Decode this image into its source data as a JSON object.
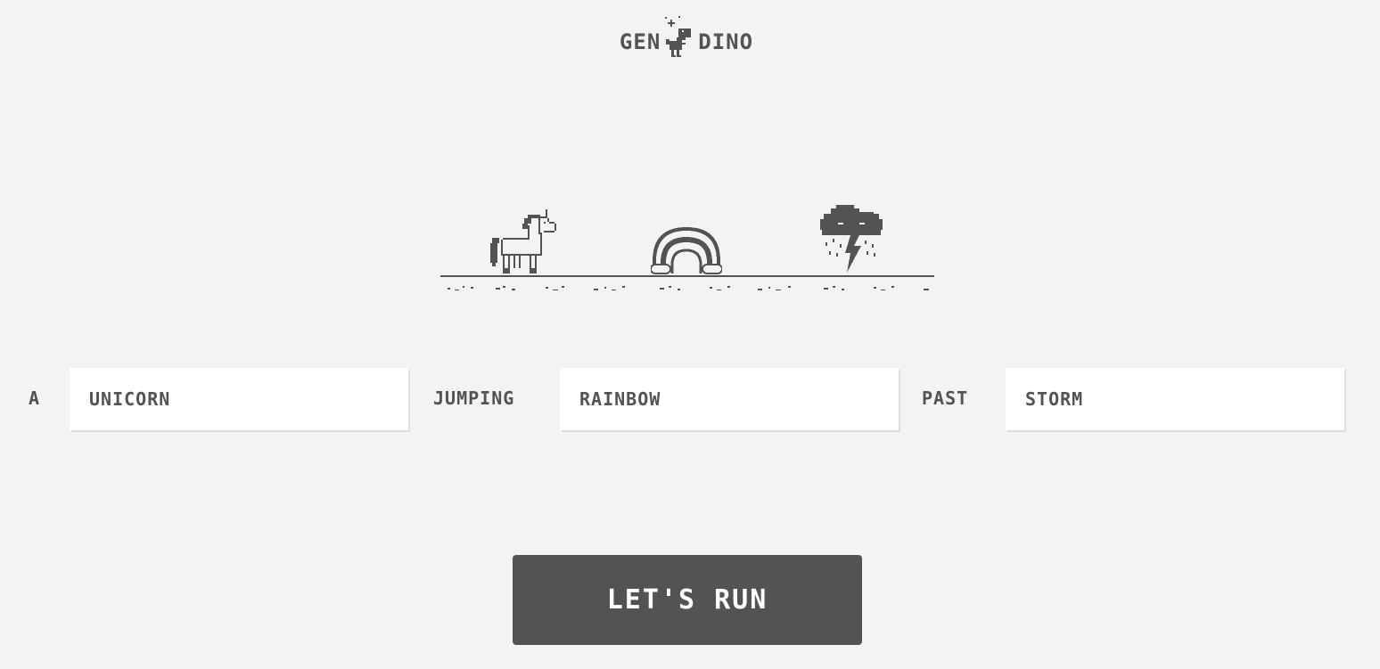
{
  "logo": {
    "left_text": "GEN",
    "right_text": "DINO"
  },
  "scene": {
    "sprites": [
      {
        "icon": "unicorn-icon"
      },
      {
        "icon": "rainbow-icon"
      },
      {
        "icon": "storm-cloud-icon"
      }
    ],
    "color": "#535353"
  },
  "prompt": {
    "word_1": "A",
    "subject": "UNICORN",
    "word_2": "JUMPING",
    "object_1": "RAINBOW",
    "word_3": "PAST",
    "object_2": "STORM"
  },
  "run_button": {
    "label": "LET'S RUN"
  },
  "colors": {
    "background": "#f3f3f3",
    "ink": "#535353",
    "field": "#ffffff"
  }
}
